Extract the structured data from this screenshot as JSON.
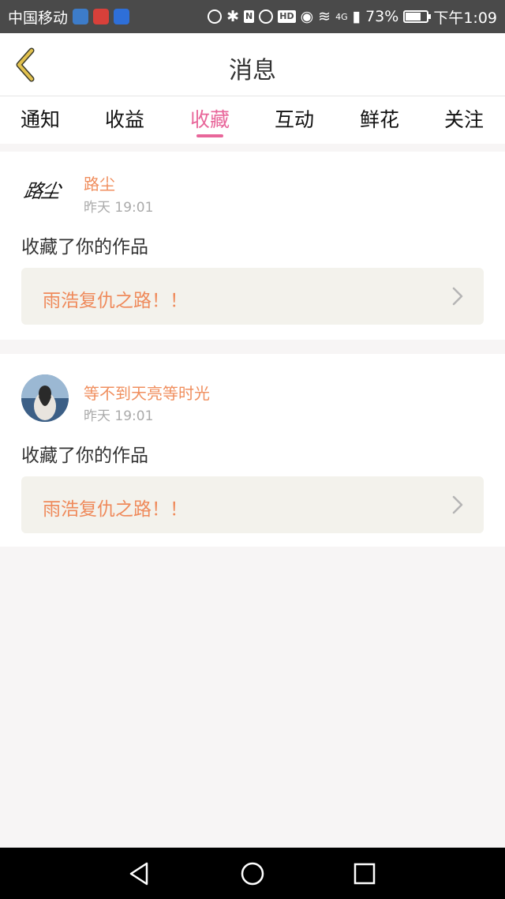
{
  "status_bar": {
    "carrier": "中国移动",
    "network": "4G",
    "battery": "73%",
    "battery_level": 0.73,
    "time": "下午1:09"
  },
  "header": {
    "title": "消息"
  },
  "tabs": [
    {
      "label": "通知",
      "active": false
    },
    {
      "label": "收益",
      "active": false
    },
    {
      "label": "收藏",
      "active": true
    },
    {
      "label": "互动",
      "active": false
    },
    {
      "label": "鲜花",
      "active": false
    },
    {
      "label": "关注",
      "active": false
    }
  ],
  "messages": [
    {
      "user": "路尘",
      "time": "昨天 19:01",
      "action": "收藏了你的作品",
      "work_title": "雨浩复仇之路！！",
      "avatar_text": "路尘"
    },
    {
      "user": "等不到天亮等时光",
      "time": "昨天 19:01",
      "action": "收藏了你的作品",
      "work_title": "雨浩复仇之路！！"
    }
  ],
  "colors": {
    "accent": "#e8669a",
    "name": "#f08f5f",
    "work_title": "#ef8a5b",
    "work_bg": "#f3f2ec",
    "back_icon": "#e2c14e"
  }
}
